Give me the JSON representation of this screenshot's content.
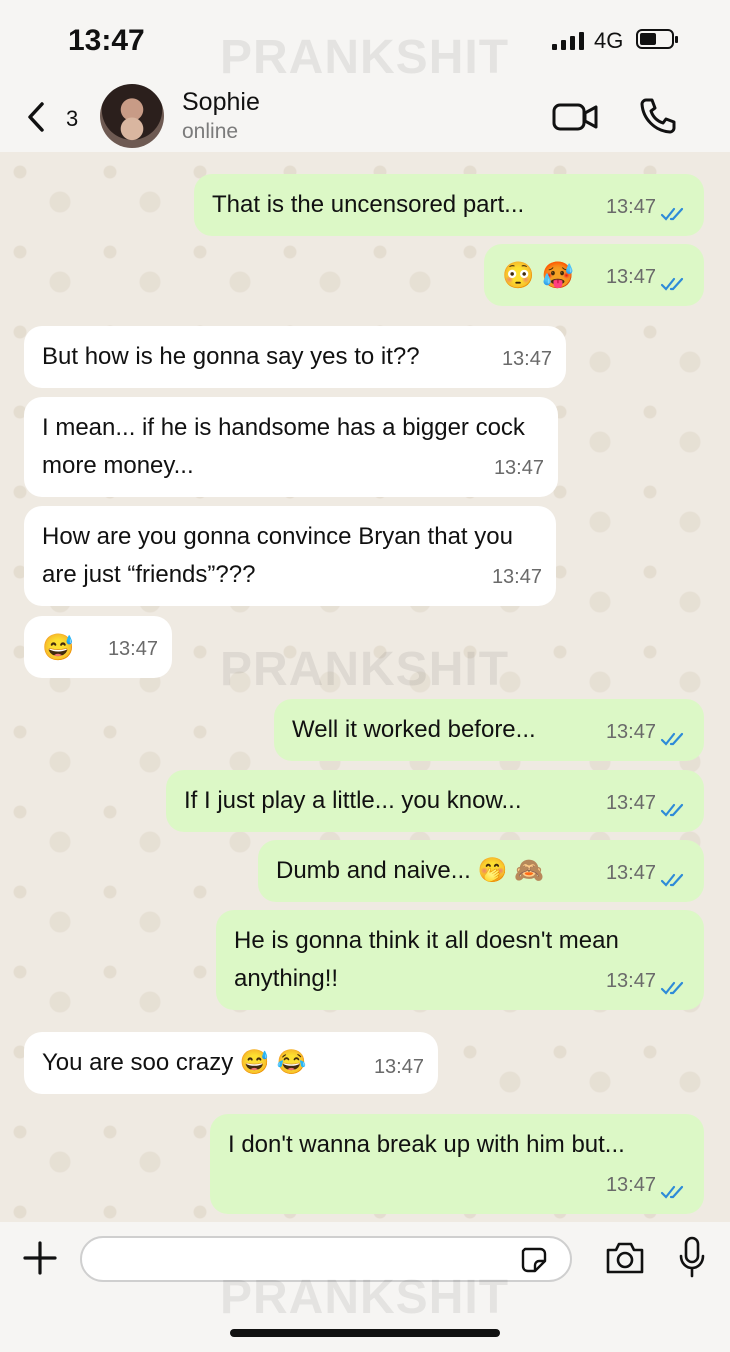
{
  "status": {
    "time": "13:47",
    "network": "4G"
  },
  "watermark": "PRANKSHIT",
  "header": {
    "back_count": "3",
    "contact_name": "Sophie",
    "contact_status": "online"
  },
  "messages": [
    {
      "dir": "out",
      "text": "That is the uncensored part...",
      "time": "13:47",
      "read": true
    },
    {
      "dir": "out",
      "text": "😳 🥵",
      "time": "13:47",
      "read": true
    },
    {
      "dir": "in",
      "text": "But how is he gonna say yes to it??",
      "time": "13:47"
    },
    {
      "dir": "in",
      "text": "I mean... if he is handsome has a bigger cock more money...",
      "time": "13:47"
    },
    {
      "dir": "in",
      "text": "How are you gonna convince Bryan that you are just “friends”???",
      "time": "13:47"
    },
    {
      "dir": "in",
      "text": "😅",
      "time": "13:47"
    },
    {
      "dir": "out",
      "text": "Well it worked before...",
      "time": "13:47",
      "read": true
    },
    {
      "dir": "out",
      "text": "If I just play a little... you know...",
      "time": "13:47",
      "read": true
    },
    {
      "dir": "out",
      "text": "Dumb and naive... 🤭 🙈",
      "time": "13:47",
      "read": true
    },
    {
      "dir": "out",
      "text": "He is gonna think it all doesn't mean anything!!",
      "time": "13:47",
      "read": true
    },
    {
      "dir": "in",
      "text": "You are soo crazy 😅 😂",
      "time": "13:47"
    },
    {
      "dir": "out",
      "text": "I don't wanna break up with him but...",
      "time": "13:47",
      "read": true
    }
  ],
  "colors": {
    "outgoing": "#dcf8c6",
    "incoming": "#ffffff",
    "read_ticks": "#2e8bd8"
  },
  "icons": {
    "back": "chevron-left-icon",
    "video": "video-camera-icon",
    "call": "phone-icon",
    "add": "plus-icon",
    "sticker": "sticker-icon",
    "camera": "camera-icon",
    "mic": "microphone-icon",
    "ticks": "double-check-icon",
    "signal": "signal-bars-icon",
    "battery": "battery-icon"
  },
  "composer": {
    "value": ""
  }
}
